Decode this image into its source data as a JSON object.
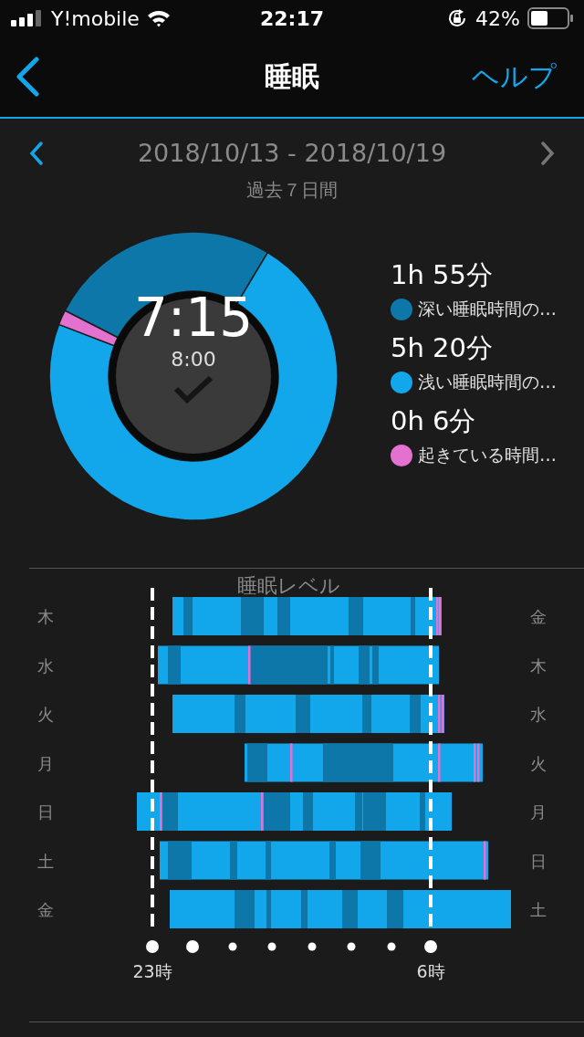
{
  "status_bar": {
    "carrier": "Y!mobile",
    "time": "22:17",
    "battery": "42%"
  },
  "nav": {
    "title": "睡眠",
    "help": "ヘルプ"
  },
  "period": {
    "range": "2018/10/13 - 2018/10/19",
    "subtitle": "過去７日間",
    "next_disabled": true
  },
  "summary": {
    "total": "7:15",
    "goal": "8:00",
    "goal_met": true
  },
  "legend": [
    {
      "value": "1h 55分",
      "label": "深い睡眠時間の…",
      "color": "#0d77a9"
    },
    {
      "value": "5h 20分",
      "label": "浅い睡眠時間の…",
      "color": "#11a7ea"
    },
    {
      "value": "0h 6分",
      "label": "起きている時間…",
      "color": "#e271cf"
    }
  ],
  "sleep_levels": {
    "title": "睡眠レベル",
    "rows": [
      {
        "start_day": "木",
        "end_day": "金"
      },
      {
        "start_day": "水",
        "end_day": "木"
      },
      {
        "start_day": "火",
        "end_day": "水"
      },
      {
        "start_day": "月",
        "end_day": "火"
      },
      {
        "start_day": "日",
        "end_day": "月"
      },
      {
        "start_day": "土",
        "end_day": "日"
      },
      {
        "start_day": "金",
        "end_day": "土"
      }
    ],
    "axis_labels": [
      "23時",
      "6時"
    ]
  }
}
